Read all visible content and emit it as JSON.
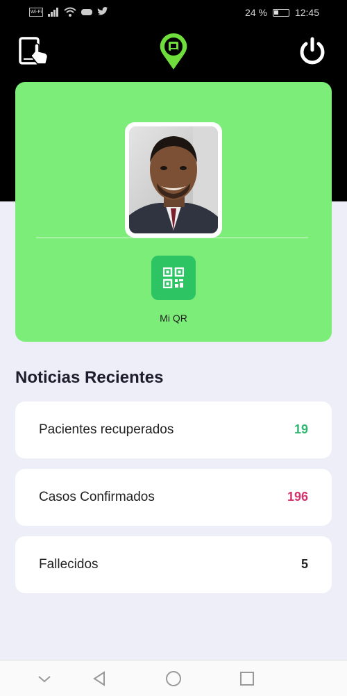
{
  "status_bar": {
    "left_box": "Wi-Fi",
    "battery_text": "24 %",
    "time": "12:45"
  },
  "header": {
    "left_icon": "tablet-touch-icon",
    "logo": "location-pin-logo",
    "right_icon": "power-icon"
  },
  "profile": {
    "qr_label": "Mi QR"
  },
  "news": {
    "title": "Noticias Recientes",
    "items": [
      {
        "label": "Pacientes recuperados",
        "value": "19",
        "color": "#2fb871"
      },
      {
        "label": "Casos Confirmados",
        "value": "196",
        "color": "#d6336c"
      },
      {
        "label": "Fallecidos",
        "value": "5",
        "color": "#222222"
      }
    ]
  },
  "colors": {
    "card_green": "#7ded79",
    "qr_green": "#2dc463",
    "header_black": "#000000",
    "page_bg": "#eeeef8"
  },
  "nav": {
    "back": "triangle-back-icon",
    "home": "circle-home-icon",
    "recent": "square-recent-icon",
    "down": "chevron-down-icon"
  }
}
